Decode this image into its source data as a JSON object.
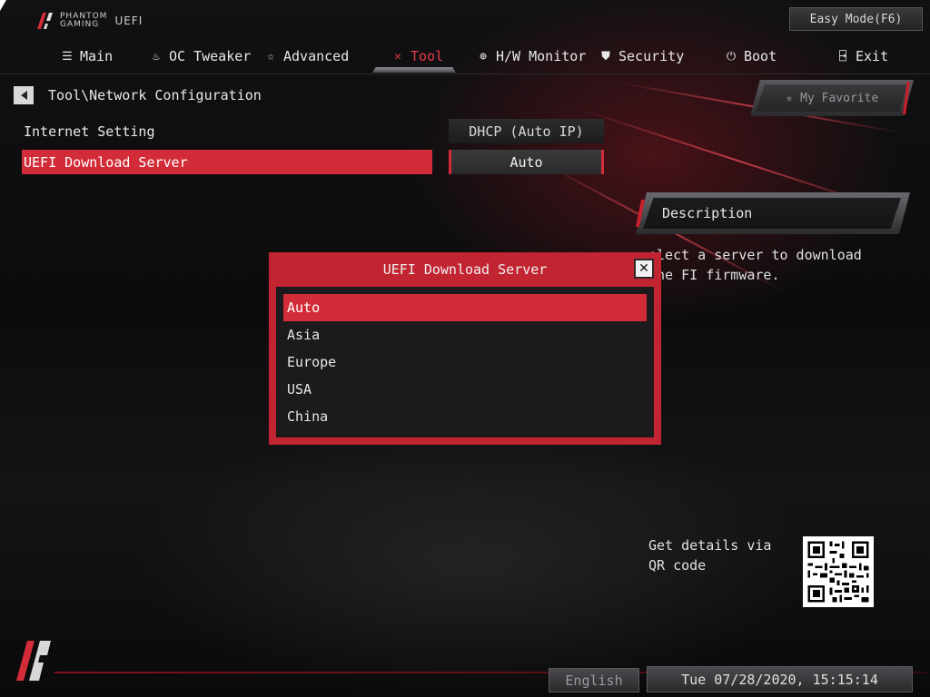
{
  "branding": {
    "line1": "PHANTOM",
    "line2": "GAMING",
    "product": "UEFI"
  },
  "header": {
    "easy_mode_label": "Easy Mode(F6)"
  },
  "nav": {
    "tabs": [
      {
        "label": "Main",
        "icon": "list-icon"
      },
      {
        "label": "OC Tweaker",
        "icon": "rocket-icon"
      },
      {
        "label": "Advanced",
        "icon": "star-icon"
      },
      {
        "label": "Tool",
        "icon": "tools-icon",
        "active": true
      },
      {
        "label": "H/W Monitor",
        "icon": "crosshair-icon"
      },
      {
        "label": "Security",
        "icon": "shield-icon"
      },
      {
        "label": "Boot",
        "icon": "power-icon"
      },
      {
        "label": "Exit",
        "icon": "exit-icon"
      }
    ]
  },
  "breadcrumb": "Tool\\Network Configuration",
  "settings": [
    {
      "label": "Internet Setting",
      "value": "DHCP (Auto IP)"
    },
    {
      "label": "UEFI Download Server",
      "value": "Auto",
      "selected": true
    }
  ],
  "favorite": {
    "label": "My Favorite"
  },
  "description": {
    "title": "Description",
    "text": "elect a server to download the FI firmware."
  },
  "dialog": {
    "title": "UEFI Download Server",
    "options": [
      "Auto",
      "Asia",
      "Europe",
      "USA",
      "China"
    ],
    "selected_index": 0
  },
  "qr": {
    "text": "Get details via QR code"
  },
  "footer": {
    "language": "English",
    "datetime": "Tue 07/28/2020, 15:15:14"
  },
  "colors": {
    "accent": "#d22c38",
    "background": "#0b0b0c"
  }
}
